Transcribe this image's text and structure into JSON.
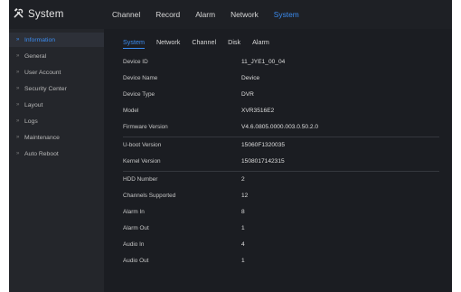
{
  "app": {
    "title": "System"
  },
  "topnav": {
    "items": [
      {
        "label": "Channel"
      },
      {
        "label": "Record"
      },
      {
        "label": "Alarm"
      },
      {
        "label": "Network"
      },
      {
        "label": "System"
      }
    ],
    "active_index": 4
  },
  "sidebar": {
    "items": [
      {
        "label": "Information"
      },
      {
        "label": "General"
      },
      {
        "label": "User Account"
      },
      {
        "label": "Security Center"
      },
      {
        "label": "Layout"
      },
      {
        "label": "Logs"
      },
      {
        "label": "Maintenance"
      },
      {
        "label": "Auto Reboot"
      }
    ],
    "active_index": 0
  },
  "subtabs": {
    "items": [
      {
        "label": "System"
      },
      {
        "label": "Network"
      },
      {
        "label": "Channel"
      },
      {
        "label": "Disk"
      },
      {
        "label": "Alarm"
      }
    ],
    "active_index": 0
  },
  "info": {
    "rows": [
      {
        "label": "Device ID",
        "value": "11_JYE1_00_04"
      },
      {
        "label": "Device Name",
        "value": "Device"
      },
      {
        "label": "Device Type",
        "value": "DVR"
      },
      {
        "label": "Model",
        "value": "XVR3516E2"
      },
      {
        "label": "Firmware Version",
        "value": "V4.6.0805.0000.003.0.50.2.0"
      },
      {
        "label": "U-boot Version",
        "value": "15060F1320035"
      },
      {
        "label": "Kernel Version",
        "value": "1508017142315"
      },
      {
        "label": "HDD Number",
        "value": "2"
      },
      {
        "label": "Channels Supported",
        "value": "12"
      },
      {
        "label": "Alarm In",
        "value": "8"
      },
      {
        "label": "Alarm Out",
        "value": "1"
      },
      {
        "label": "Audio In",
        "value": "4"
      },
      {
        "label": "Audio Out",
        "value": "1"
      }
    ]
  },
  "colors": {
    "accent": "#3b8cf0",
    "background": "#1b1d22",
    "sidebar": "#24262b",
    "sidebar_active": "#2d3038"
  },
  "icons": {
    "brand": "tools-icon",
    "sidebar_bullet": "chevron-right-icon"
  }
}
